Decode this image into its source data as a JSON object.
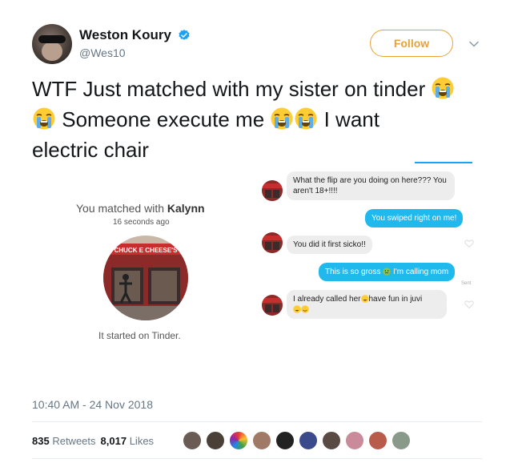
{
  "author": {
    "display_name": "Weston Koury",
    "handle": "@Wes10",
    "verified": true,
    "avatar_icon": "profile-avatar"
  },
  "follow_button": {
    "label": "Follow",
    "color": "#e8a23a"
  },
  "tweet": {
    "line1": "WTF Just matched with my sister on tinder ",
    "line2": " Someone execute me ",
    "line3": " I want",
    "line4": "electric chair",
    "emoji": "loudly-crying-face"
  },
  "media": {
    "match_prefix": "You matched with ",
    "match_name": "Kalynn",
    "match_time": "16 seconds ago",
    "sign_text": "CHUCK E CHEESE'S",
    "started": "It started on Tinder.",
    "messages": [
      {
        "from": "them",
        "text": "What the flip are you doing on here??? You aren't 18+!!!!"
      },
      {
        "from": "me",
        "text": "You swiped right on me!"
      },
      {
        "from": "them",
        "text": "You did it first sicko!!"
      },
      {
        "from": "me",
        "text_before": "This is so gross ",
        "text_after": " I'm calling mom",
        "status": "Sent"
      },
      {
        "from": "them",
        "text_before": "I already called her",
        "text_after": "have fun in juvi"
      }
    ]
  },
  "timestamp": "10:40 AM - 24 Nov 2018",
  "stats": {
    "retweets_count": "835",
    "retweets_label": "Retweets",
    "likes_count": "8,017",
    "likes_label": "Likes"
  },
  "colors": {
    "accent": "#1da1f2",
    "chat_blue": "#20b9ee",
    "verified_blue": "#1da1f2"
  }
}
